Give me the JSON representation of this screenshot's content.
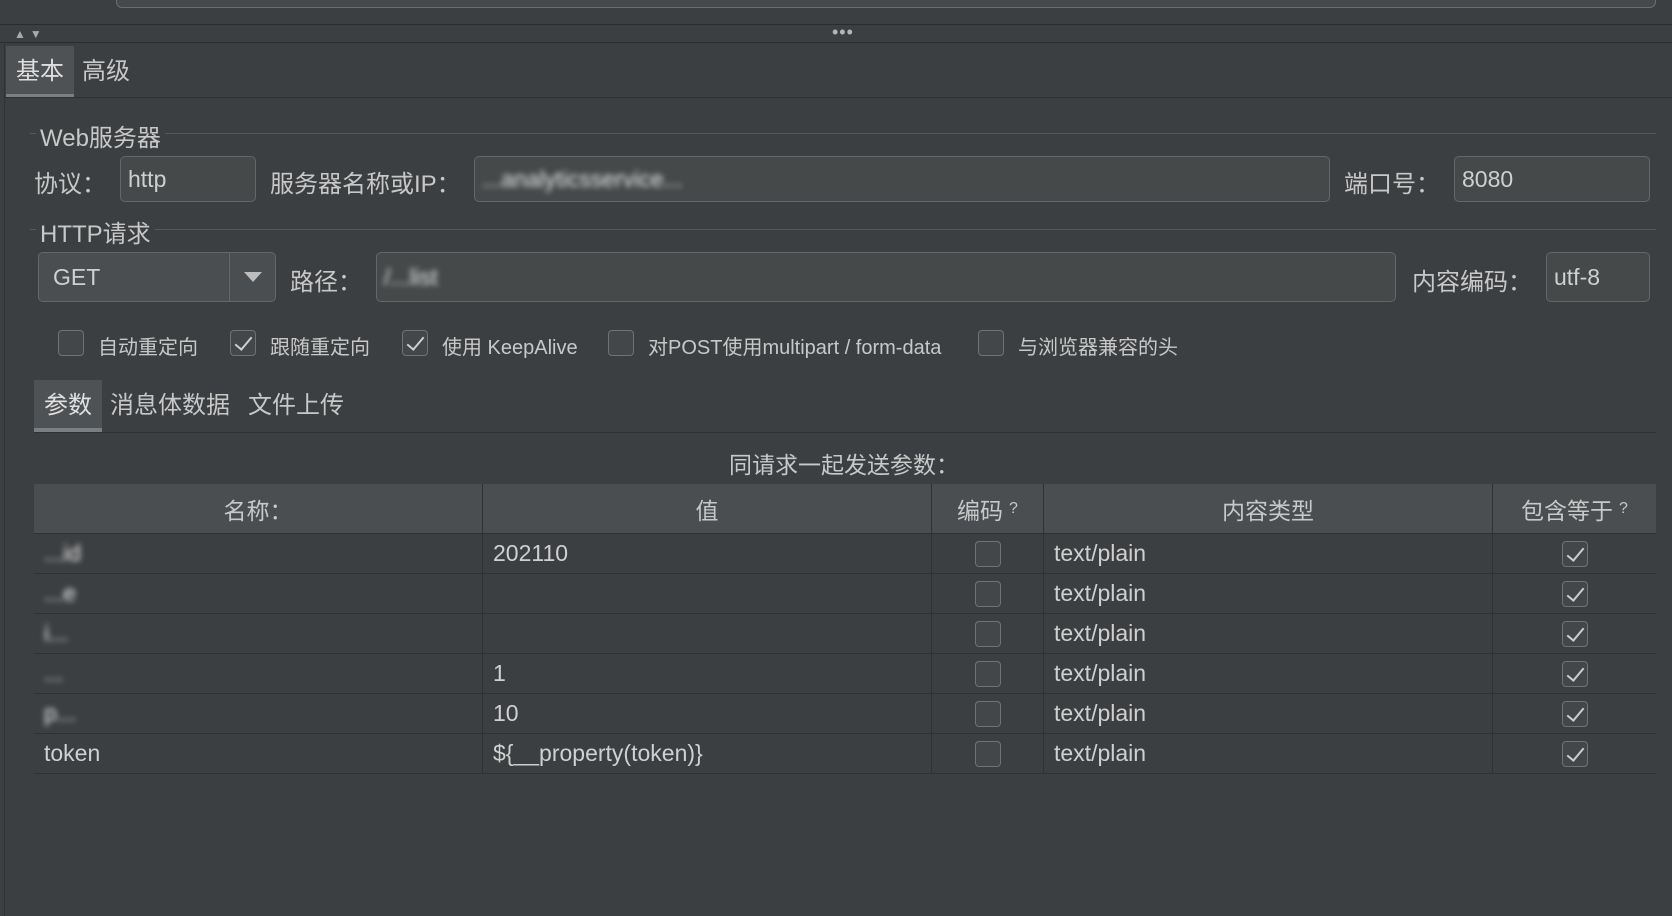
{
  "tabs": [
    "基本",
    "高级"
  ],
  "web_server": {
    "section_title": "Web服务器",
    "protocol_label": "协议：",
    "protocol_value": "http",
    "server_label": "服务器名称或IP：",
    "server_value": "...analyticsservice...",
    "port_label": "端口号：",
    "port_value": "8080"
  },
  "http_request": {
    "section_title": "HTTP请求",
    "method": "GET",
    "path_label": "路径：",
    "path_value": "/...list",
    "encoding_label": "内容编码：",
    "encoding_value": "utf-8"
  },
  "options": [
    {
      "label": "自动重定向",
      "checked": false
    },
    {
      "label": "跟随重定向",
      "checked": true
    },
    {
      "label": "使用 KeepAlive",
      "checked": true
    },
    {
      "label": "对POST使用multipart / form-data",
      "checked": false
    },
    {
      "label": "与浏览器兼容的头",
      "checked": false
    }
  ],
  "sub_tabs": [
    "参数",
    "消息体数据",
    "文件上传"
  ],
  "table": {
    "caption": "同请求一起发送参数：",
    "headers": {
      "name": "名称：",
      "value": "值",
      "encode": "编码",
      "encode_hint": "?",
      "content_type": "内容类型",
      "include_equals": "包含等于",
      "include_equals_hint": "?"
    },
    "rows": [
      {
        "name": "...id",
        "value": "202110",
        "encode": false,
        "content_type": "text/plain",
        "include_equals": true,
        "blurred": true
      },
      {
        "name": "...e",
        "value": "",
        "encode": false,
        "content_type": "text/plain",
        "include_equals": true,
        "blurred": true
      },
      {
        "name": "i...",
        "value": "",
        "encode": false,
        "content_type": "text/plain",
        "include_equals": true,
        "blurred": true
      },
      {
        "name": "...",
        "value": "1",
        "encode": false,
        "content_type": "text/plain",
        "include_equals": true,
        "blurred": true
      },
      {
        "name": "p...",
        "value": "10",
        "encode": false,
        "content_type": "text/plain",
        "include_equals": true,
        "blurred": true
      },
      {
        "name": "token",
        "value": "${__property(token)}",
        "encode": false,
        "content_type": "text/plain",
        "include_equals": true,
        "blurred": false
      }
    ]
  }
}
